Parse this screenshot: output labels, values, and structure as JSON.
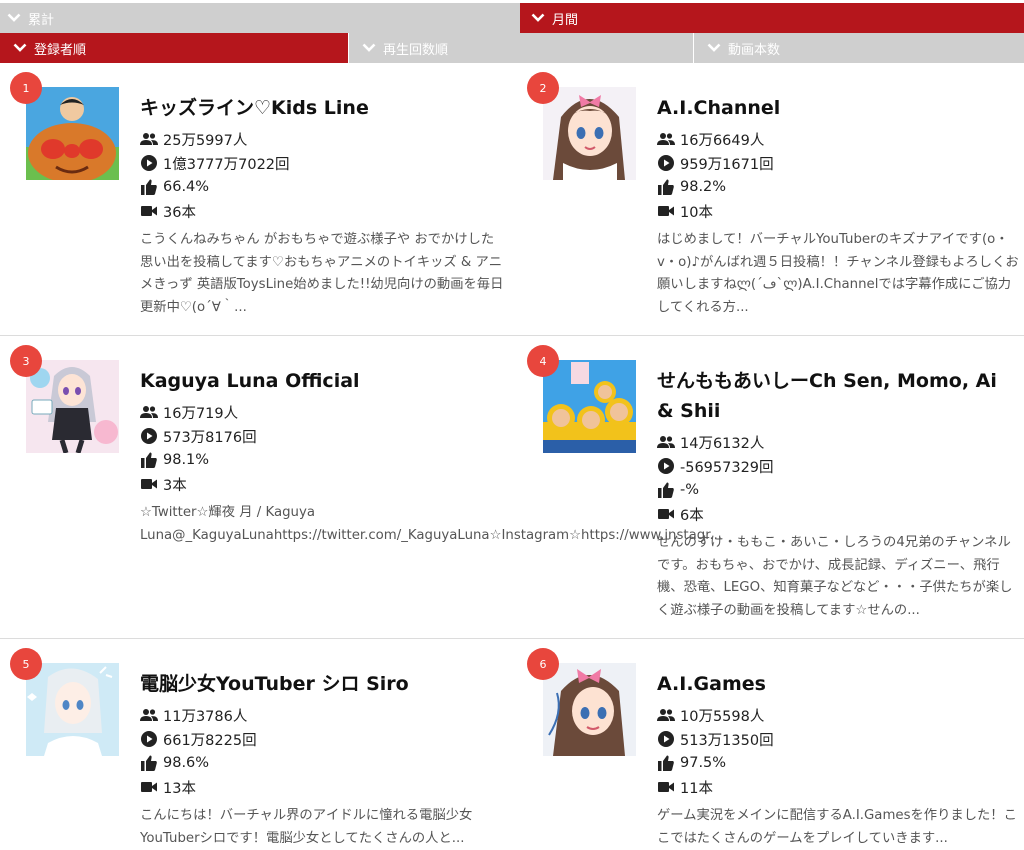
{
  "tabs": {
    "period": [
      {
        "label": "累計",
        "active": false
      },
      {
        "label": "月間",
        "active": true
      }
    ],
    "sort": [
      {
        "label": "登録者順",
        "active": true
      },
      {
        "label": "再生回数順",
        "active": false
      },
      {
        "label": "動画本数",
        "active": false
      }
    ]
  },
  "colors": {
    "accent": "#b5161c",
    "inactive_tab": "#cfcfcf",
    "rank_badge": "#e8463d"
  },
  "icons": {
    "subscribers": "people-icon",
    "views": "play-circle-icon",
    "likes": "thumbs-up-icon",
    "videos": "video-camera-icon",
    "tab": "chevron-down-icon"
  },
  "channels": [
    {
      "rank": "1",
      "title": "キッズライン♡Kids Line",
      "subscribers": "25万5997人",
      "views": "1億3777万7022回",
      "likes": "66.4%",
      "videos": "36本",
      "desc": "こうくんねみちゃん がおもちゃで遊ぶ様子や おでかけした思い出を投稿してます♡おもちゃアニメのトイキッズ & アニメきっず 英語版ToysLine始めました!!幼児向けの動画を毎日 更新中♡(o´∀｀..."
    },
    {
      "rank": "2",
      "title": "A.I.Channel",
      "subscribers": "16万6649人",
      "views": "959万1671回",
      "likes": "98.2%",
      "videos": "10本",
      "desc": "はじめまして！バーチャルYouTuberのキズナアイです(o・v・o)♪がんばれ週５日投稿！！チャンネル登録もよろしくお願いしますねლ(´ڡ`ლ)A.I.Channelでは字幕作成にご協力してくれる方..."
    },
    {
      "rank": "3",
      "title": "Kaguya Luna Official",
      "subscribers": "16万719人",
      "views": "573万8176回",
      "likes": "98.1%",
      "videos": "3本",
      "desc": "☆Twitter☆輝夜 月 / Kaguya Luna@_KaguyaLunahttps://twitter.com/_KaguyaLuna☆Instagram☆https://www.instagr..."
    },
    {
      "rank": "4",
      "title": "せんももあいしーCh Sen, Momo, Ai & Shii",
      "subscribers": "14万6132人",
      "views": "-56957329回",
      "likes": "-%",
      "videos": "6本",
      "desc": "せんのすけ・ももこ・あいこ・しろうの4兄弟のチャンネルです。おもちゃ、おでかけ、成長記録、ディズニー、飛行機、恐竜、LEGO、知育菓子などなど・・・子供たちが楽しく遊ぶ様子の動画を投稿してます☆せんの..."
    },
    {
      "rank": "5",
      "title": "電脳少女YouTuber シロ Siro",
      "subscribers": "11万3786人",
      "views": "661万8225回",
      "likes": "98.6%",
      "videos": "13本",
      "desc": "こんにちは！バーチャル界のアイドルに憧れる電脳少女YouTuberシロです！電脳少女としてたくさんの人と..."
    },
    {
      "rank": "6",
      "title": "A.I.Games",
      "subscribers": "10万5598人",
      "views": "513万1350回",
      "likes": "97.5%",
      "videos": "11本",
      "desc": "ゲーム実況をメインに配信するA.I.Gamesを作りました！ここではたくさんのゲームをプレイしていきます..."
    }
  ]
}
